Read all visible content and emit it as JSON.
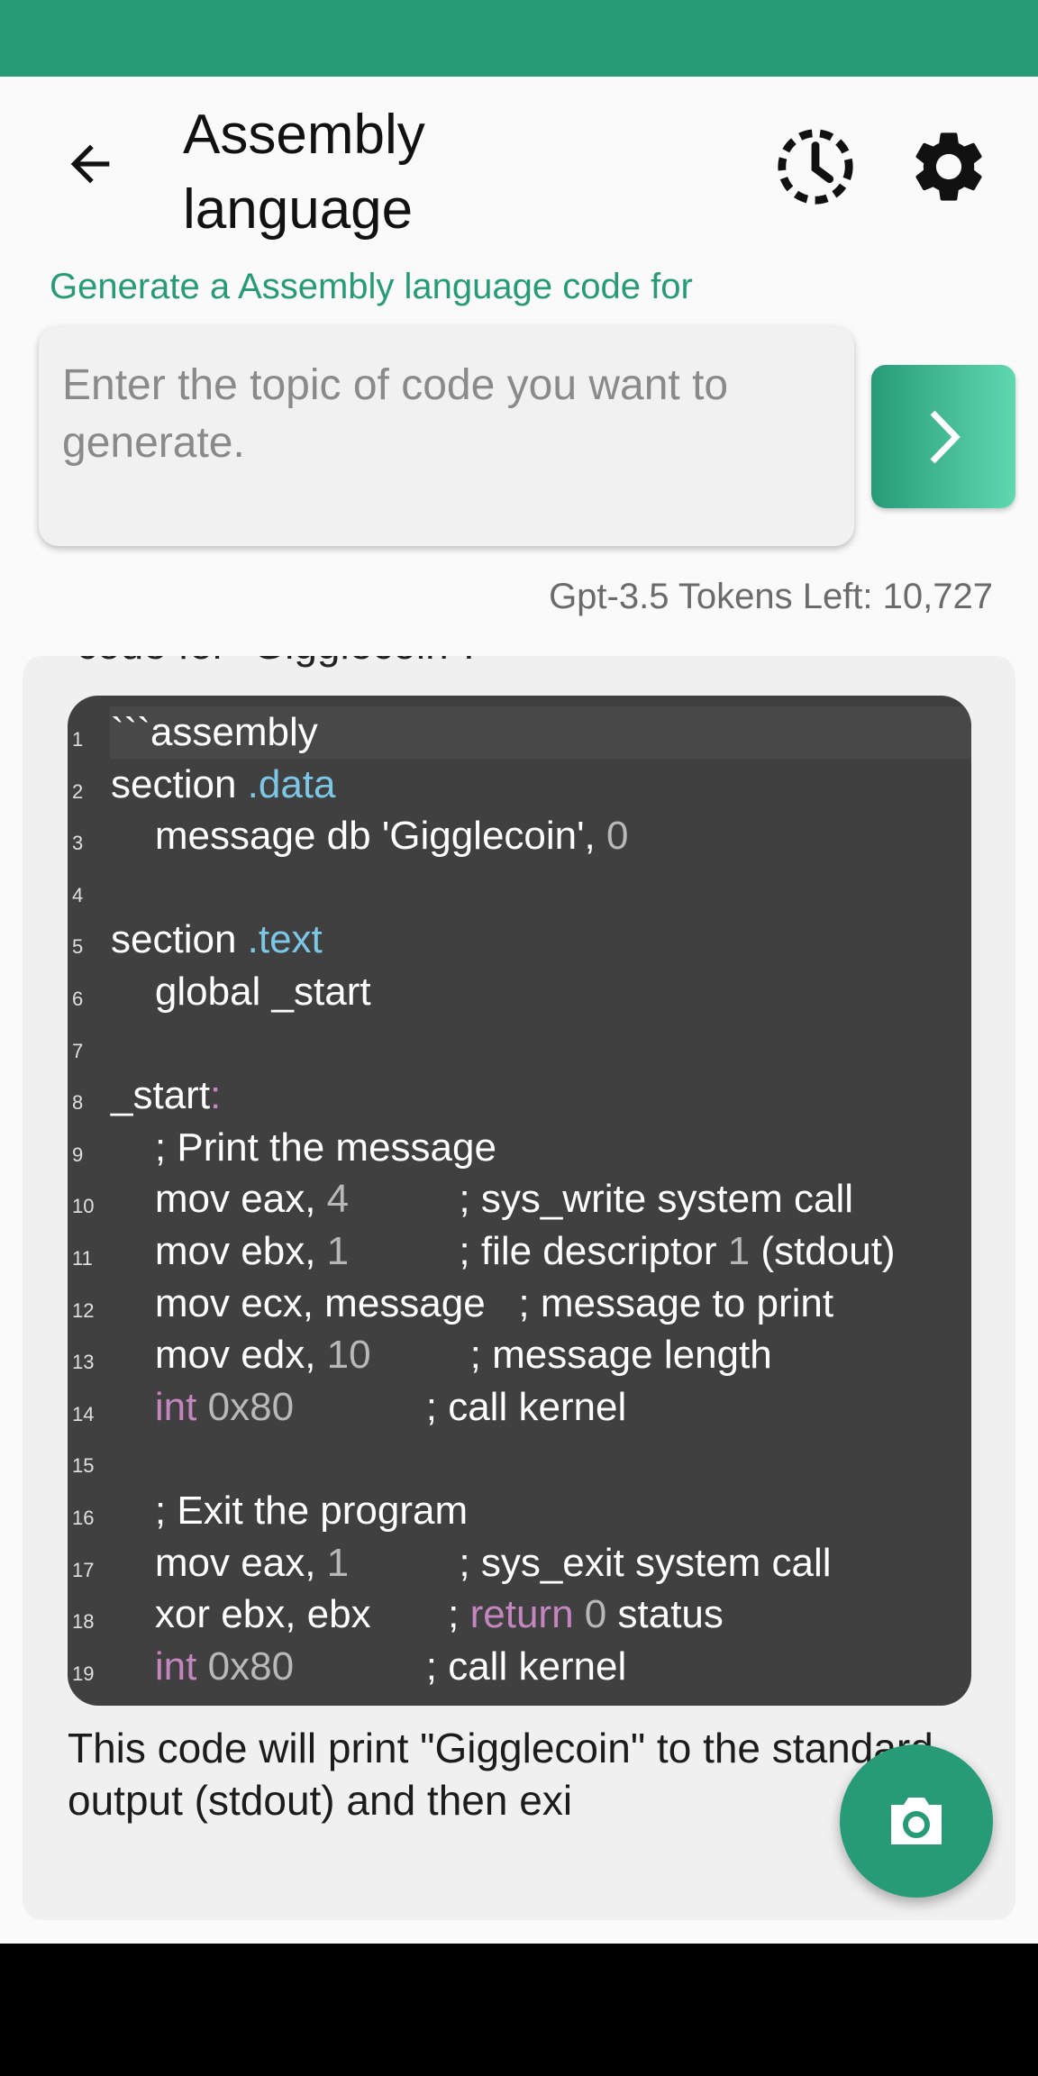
{
  "header": {
    "title": "Assembly language",
    "back_icon": "arrow-left-icon",
    "history_icon": "history-icon",
    "settings_icon": "gear-icon"
  },
  "prompt": {
    "label": "Generate a Assembly language code for",
    "placeholder": "Enter the topic of code you want to generate.",
    "send_icon": "chevron-right-icon"
  },
  "tokens": "Gpt-3.5 Tokens Left: 10,727",
  "response": {
    "intro_cut": "code for \"Gigglecoin\":",
    "code_lines": [
      [
        [
          "```assembly",
          ""
        ]
      ],
      [
        [
          "section ",
          ""
        ],
        [
          ".data",
          "kw"
        ]
      ],
      [
        [
          "    message db 'Gigglecoin', ",
          ""
        ],
        [
          "0",
          "num"
        ]
      ],
      [],
      [
        [
          "section ",
          ""
        ],
        [
          ".text",
          "kw"
        ]
      ],
      [
        [
          "    global _start",
          ""
        ]
      ],
      [],
      [
        [
          "_start",
          ""
        ],
        [
          ":",
          "pur"
        ]
      ],
      [
        [
          "    ; Print the message",
          ""
        ]
      ],
      [
        [
          "    mov eax, ",
          ""
        ],
        [
          "4",
          "num"
        ],
        [
          "          ; sys_write system call",
          ""
        ]
      ],
      [
        [
          "    mov ebx, ",
          ""
        ],
        [
          "1",
          "num"
        ],
        [
          "          ; file descriptor ",
          ""
        ],
        [
          "1",
          "num"
        ],
        [
          " (stdout)",
          ""
        ]
      ],
      [
        [
          "    mov ecx, message   ; message to print",
          ""
        ]
      ],
      [
        [
          "    mov edx, ",
          ""
        ],
        [
          "10",
          "num"
        ],
        [
          "         ; message length",
          ""
        ]
      ],
      [
        [
          "    ",
          ""
        ],
        [
          "int",
          "pur"
        ],
        [
          " ",
          ""
        ],
        [
          "0x80",
          "num"
        ],
        [
          "            ; call kernel",
          ""
        ]
      ],
      [],
      [
        [
          "    ; Exit the program",
          ""
        ]
      ],
      [
        [
          "    mov eax, ",
          ""
        ],
        [
          "1",
          "num"
        ],
        [
          "          ; sys_exit system call",
          ""
        ]
      ],
      [
        [
          "    xor ebx, ebx       ; ",
          ""
        ],
        [
          "return",
          "pur"
        ],
        [
          " ",
          ""
        ],
        [
          "0",
          "num"
        ],
        [
          " status",
          ""
        ]
      ],
      [
        [
          "    ",
          ""
        ],
        [
          "int",
          "pur"
        ],
        [
          " ",
          ""
        ],
        [
          "0x80",
          "num"
        ],
        [
          "            ; call kernel",
          ""
        ]
      ]
    ],
    "outro": "This code will print \"Gigglecoin\" to the standard output (stdout) and then exi"
  },
  "fab_icon": "camera-icon",
  "colors": {
    "accent": "#279b78",
    "code_bg": "#404040"
  }
}
